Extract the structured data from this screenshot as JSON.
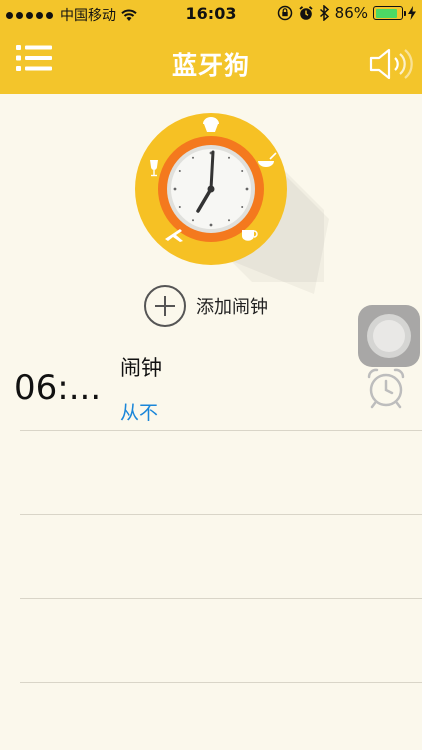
{
  "status_bar": {
    "carrier": "中国移动",
    "time": "16:03",
    "battery_percent": "86%",
    "battery_level": 0.86,
    "icons": [
      "signal-dots",
      "wifi-icon",
      "orientation-lock-icon",
      "alarm-icon",
      "bluetooth-icon",
      "battery-icon",
      "charging-bolt-icon"
    ]
  },
  "header": {
    "title": "蓝牙狗",
    "left_icon": "menu-list-icon",
    "right_icon": "speaker-icon"
  },
  "clock_graphic": {
    "icons": [
      "cupcake-icon",
      "bowl-icon",
      "coffee-cup-icon",
      "airplane-icon",
      "wine-glass-icon"
    ]
  },
  "add_alarm": {
    "label": "添加闹钟",
    "icon": "plus-circle-icon"
  },
  "alarms": [
    {
      "time": "06:...",
      "name": "闹钟",
      "repeat": "从不",
      "icon": "alarm-clock-icon"
    }
  ],
  "colors": {
    "header": "#f3c52b",
    "background": "#fbf8ec",
    "clock_outer": "#f6c124",
    "clock_ring": "#f4791e",
    "repeat_text": "#1a86d9",
    "battery": "#4cd964"
  }
}
